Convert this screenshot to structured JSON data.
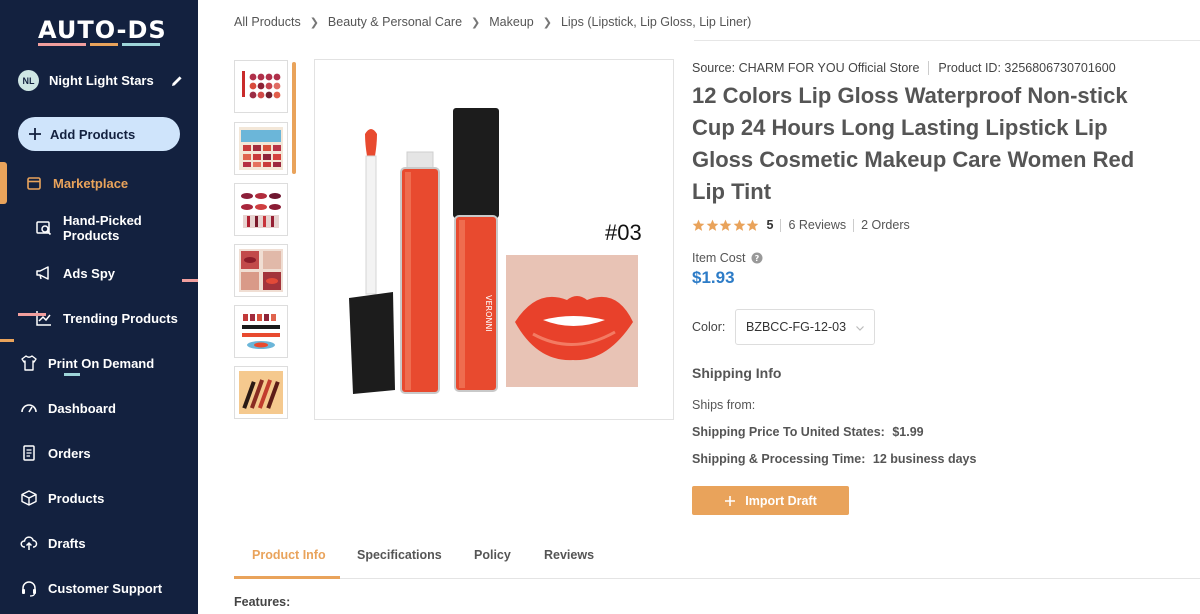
{
  "sidebar": {
    "logo": "AUTO-DS",
    "user": {
      "initials": "NL",
      "name": "Night Light Stars"
    },
    "add_products_label": "Add Products",
    "items": [
      {
        "label": "Marketplace",
        "icon": "store-icon"
      },
      {
        "label": "Hand-Picked Products",
        "icon": "hand-picked-icon"
      },
      {
        "label": "Ads Spy",
        "icon": "megaphone-icon"
      },
      {
        "label": "Trending Products",
        "icon": "trending-chart-icon"
      },
      {
        "label": "Print On Demand",
        "icon": "tshirt-icon"
      },
      {
        "label": "Dashboard",
        "icon": "gauge-icon"
      },
      {
        "label": "Orders",
        "icon": "clipboard-icon"
      },
      {
        "label": "Products",
        "icon": "box-icon"
      },
      {
        "label": "Drafts",
        "icon": "cloud-upload-icon"
      },
      {
        "label": "Customer Support",
        "icon": "headset-icon"
      }
    ]
  },
  "breadcrumb": [
    "All Products",
    "Beauty & Personal Care",
    "Makeup",
    "Lips (Lipstick, Lip Gloss, Lip Liner)"
  ],
  "product": {
    "source_label": "Source:",
    "source_value": "CHARM FOR YOU Official Store",
    "id_label": "Product ID:",
    "id_value": "3256806730701600",
    "title": "12 Colors Lip Gloss Waterproof Non-stick Cup 24 Hours Long Lasting Lipstick Lip Gloss Cosmetic Makeup Care Women Red Lip Tint",
    "rating": "5",
    "reviews": "6 Reviews",
    "orders": "2 Orders",
    "item_cost_label": "Item Cost",
    "price": "$1.93",
    "color_label": "Color:",
    "color_value": "BZBCC-FG-12-03",
    "image_label": "#03",
    "brand_text": "VERONNI"
  },
  "shipping": {
    "title": "Shipping Info",
    "ships_from": "Ships from:",
    "price_label": "Shipping Price To United States:",
    "price_value": "$1.99",
    "time_label": "Shipping & Processing Time:",
    "time_value": "12 business days"
  },
  "import_draft_label": "Import Draft",
  "tabs": [
    "Product Info",
    "Specifications",
    "Policy",
    "Reviews"
  ],
  "features_label": "Features:",
  "colors": {
    "accent": "#e9a35b",
    "sidebar": "#13213f",
    "price": "#2d7cc7",
    "lip_red": "#e84a2f"
  }
}
